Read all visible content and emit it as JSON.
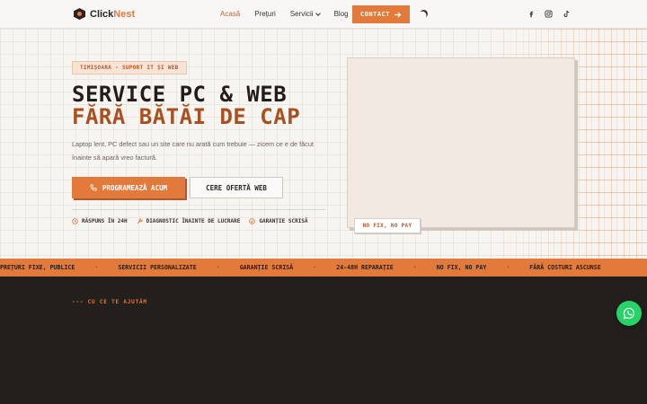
{
  "header": {
    "logo_main": "Click",
    "logo_accent": "Nest",
    "nav": [
      {
        "label": "Acasă",
        "active": true
      },
      {
        "label": "Prețuri"
      },
      {
        "label": "Servicii",
        "dropdown": true
      },
      {
        "label": "Blog"
      }
    ],
    "contact_label": "CONTACT",
    "theme_toggle_icon": "moon-icon",
    "social_icons": [
      "facebook-icon",
      "instagram-icon",
      "tiktok-icon"
    ]
  },
  "hero": {
    "badge": "TIMIȘOARA - SUPORT IT ȘI WEB",
    "title_line1": "SERVICE PC & WEB",
    "title_line2": "FĂRĂ BĂTĂI DE CAP",
    "lead": "Laptop lent, PC defect sau un site care nu arată cum trebuie — zicem ce e de făcut înainte să apară vreo factură.",
    "primary_button": "PROGRAMEAZĂ ACUM",
    "secondary_button": "CERE OFERTĂ WEB",
    "features": [
      {
        "icon": "clock-icon",
        "label": "RĂSPUNS ÎN 24H"
      },
      {
        "icon": "wrench-icon",
        "label": "DIAGNOSTIC ÎNAINTE DE LUCRARE"
      },
      {
        "icon": "check-circle-icon",
        "label": "GARANȚIE SCRISĂ"
      }
    ],
    "image_tag": "NO FIX, NO PAY"
  },
  "marquee": {
    "items": [
      "PREȚURI FIXE, PUBLICE",
      "SERVICII PERSONALIZATE",
      "GARANȚIE SCRISĂ",
      "24-48H REPARAȚIE",
      "NO FIX, NO PAY",
      "FĂRĂ COSTURI ASCUNSE"
    ],
    "separator": "·"
  },
  "services": {
    "eyebrow": "--- CU CE TE AJUTĂM"
  },
  "colors": {
    "accent": "#e27a3c",
    "accent_dark": "#a8501f",
    "dark_bg": "#231f1d",
    "whatsapp": "#25d366"
  }
}
